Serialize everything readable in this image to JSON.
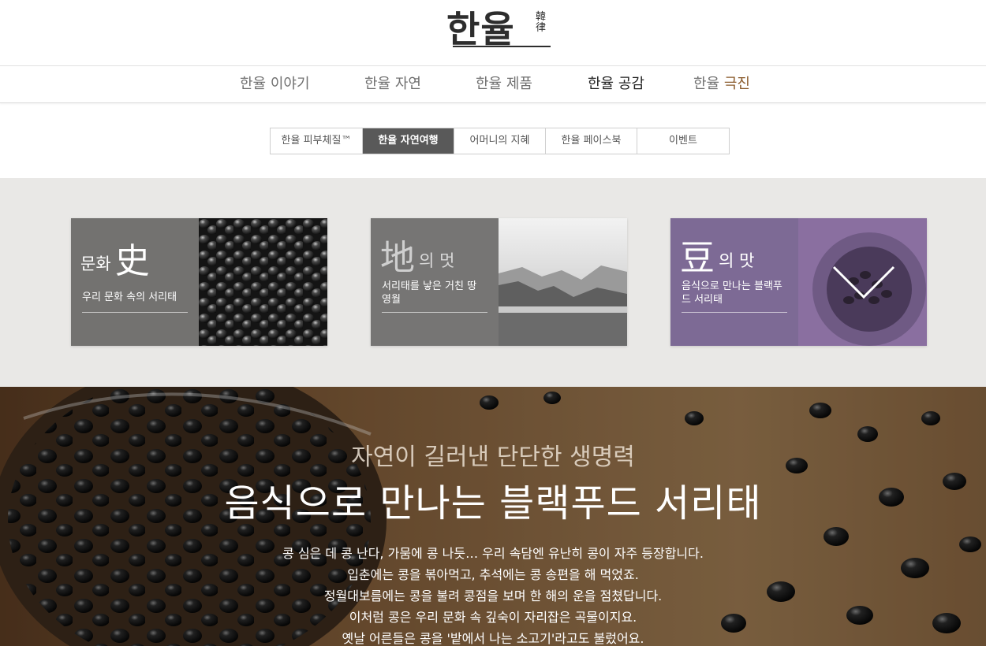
{
  "brand": {
    "logo_text": "한율",
    "logo_hanja": "韓律"
  },
  "nav": {
    "items": [
      {
        "prefix": "한율",
        "label": "이야기"
      },
      {
        "prefix": "한율",
        "label": "자연"
      },
      {
        "prefix": "한율",
        "label": "제품"
      },
      {
        "prefix": "한율",
        "label": "공감"
      },
      {
        "prefix": "한율",
        "label": "극진"
      }
    ],
    "active_index": 3
  },
  "subtabs": {
    "items": [
      "한율 피부체질™",
      "한율 자연여행",
      "어머니의 지혜",
      "한율 페이스북",
      "이벤트"
    ],
    "active_index": 1
  },
  "cards": [
    {
      "title_small_pre": "문화",
      "title_big": "史",
      "title_small_post": "",
      "subtitle": "우리 문화 속의 서리태",
      "bg_color": "#737270"
    },
    {
      "title_small_pre": "",
      "title_big": "地",
      "title_small_post": "의 멋",
      "subtitle": "서리태를 낳은 거친 땅 영월",
      "bg_color": "#767574"
    },
    {
      "title_small_pre": "",
      "title_big": "豆",
      "title_small_post": "의 맛",
      "subtitle": "음식으로 만나는 블랙푸드 서리태",
      "bg_color": "#7d6a95"
    }
  ],
  "hero": {
    "subtitle": "자연이 길러낸 단단한 생명력",
    "title": "음식으로 만나는 블랙푸드 서리태",
    "paragraph": [
      "콩 심은 데 콩 난다, 가뭄에 콩 나듯… 우리 속담엔 유난히 콩이 자주 등장합니다.",
      "입춘에는 콩을 볶아먹고, 추석에는 콩 송편을 해 먹었죠.",
      "정월대보름에는 콩을 불려 콩점을 보며 한 해의 운을 점쳤답니다.",
      "이처럼 콩은 우리 문화 속 깊숙이 자리잡은 곡물이지요.",
      "옛날 어른들은 콩을 '밭에서 나는 소고기'라고도 불렀어요."
    ]
  },
  "colors": {
    "accent_brown": "#8a5a2b",
    "active_tab": "#595959",
    "band": "#e9e8e6"
  }
}
